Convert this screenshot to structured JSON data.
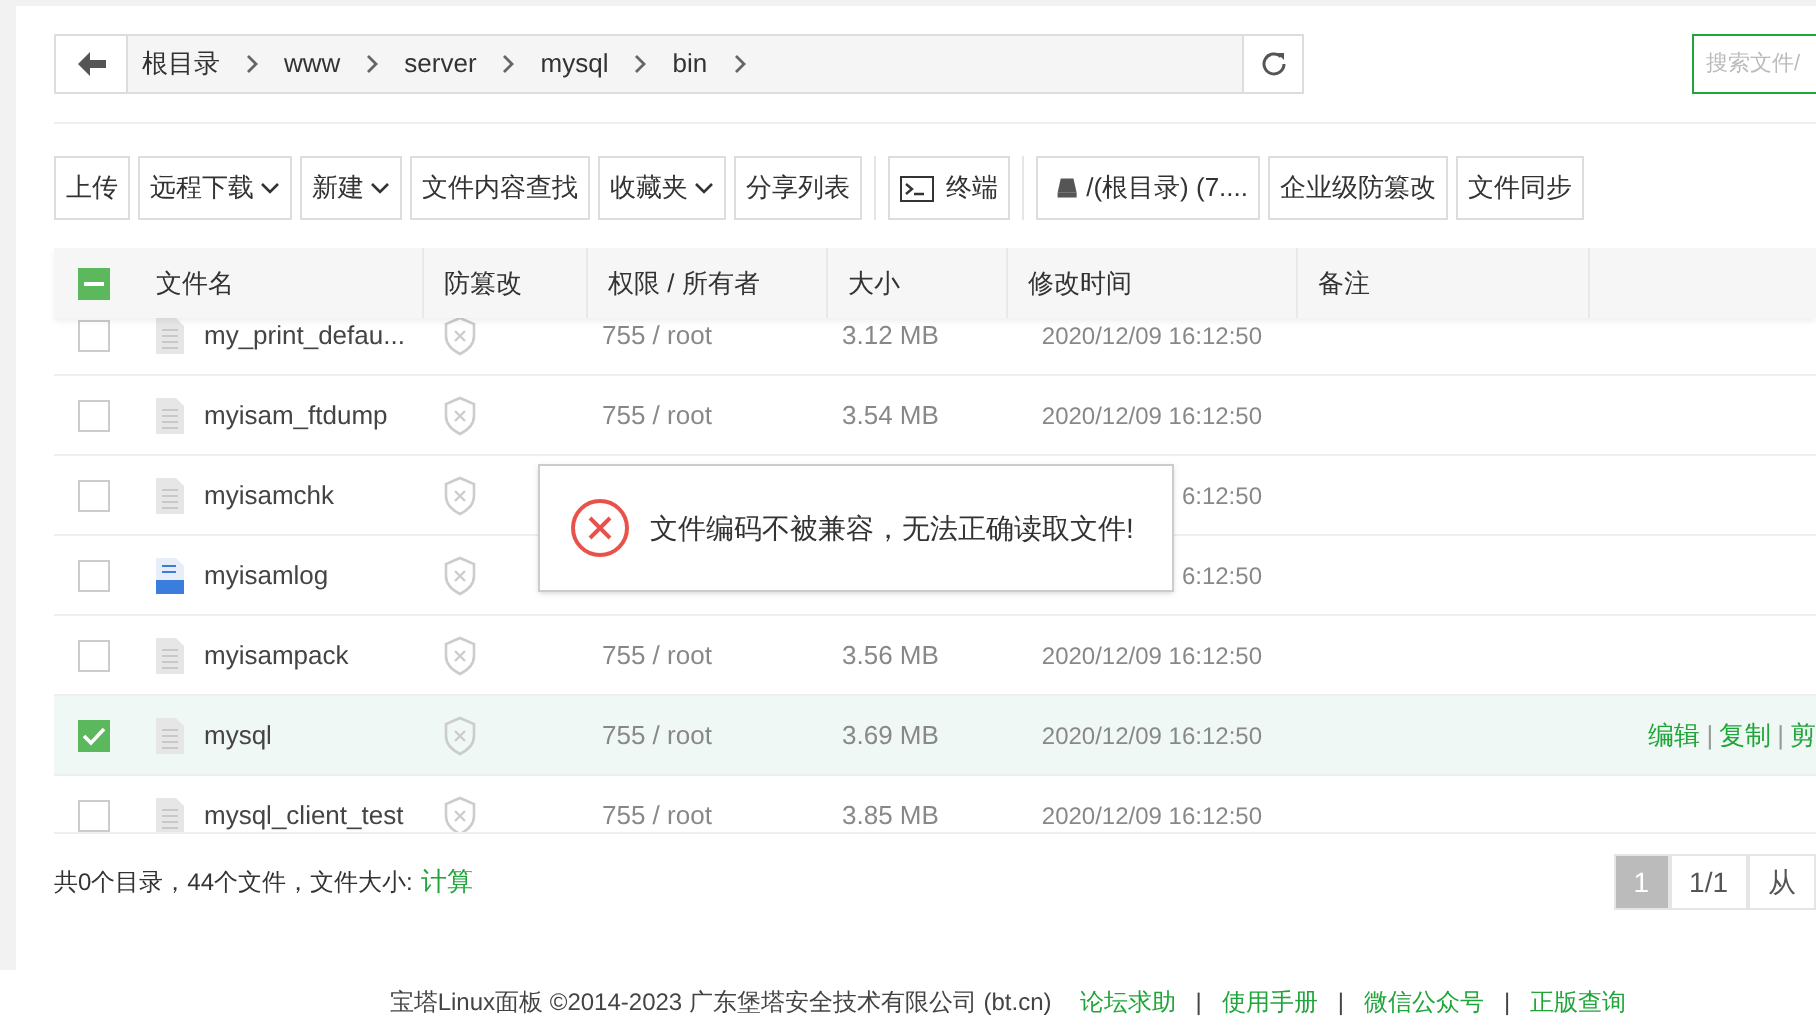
{
  "breadcrumb": [
    "根目录",
    "www",
    "server",
    "mysql",
    "bin"
  ],
  "search": {
    "placeholder": "搜索文件/"
  },
  "toolbar": [
    {
      "label": "上传",
      "kind": "plain"
    },
    {
      "label": "远程下载",
      "kind": "dropdown"
    },
    {
      "label": "新建",
      "kind": "dropdown"
    },
    {
      "label": "文件内容查找",
      "kind": "plain"
    },
    {
      "label": "收藏夹",
      "kind": "dropdown"
    },
    {
      "label": "分享列表",
      "kind": "plain"
    },
    {
      "label": "终端",
      "kind": "terminal"
    },
    {
      "label": "/(根目录) (7....",
      "kind": "disk"
    },
    {
      "label": "企业级防篡改",
      "kind": "plain"
    },
    {
      "label": "文件同步",
      "kind": "plain"
    }
  ],
  "table": {
    "select_all": {
      "indeterminate": true
    },
    "columns": [
      "文件名",
      "防篡改",
      "权限 / 所有者",
      "大小",
      "修改时间",
      "备注"
    ],
    "rows": [
      {
        "name": "my_print_defau...",
        "kind": "file",
        "permission": "755 / root",
        "size": "3.12 MB",
        "modified": "2020/12/09 16:12:50",
        "selected": false
      },
      {
        "name": "myisam_ftdump",
        "kind": "file",
        "permission": "755 / root",
        "size": "3.54 MB",
        "modified": "2020/12/09 16:12:50",
        "selected": false
      },
      {
        "name": "myisamchk",
        "kind": "file",
        "modified": "6:12:50",
        "selected": false
      },
      {
        "name": "myisamlog",
        "kind": "log",
        "modified": "6:12:50",
        "selected": false
      },
      {
        "name": "myisampack",
        "kind": "file",
        "permission": "755 / root",
        "size": "3.56 MB",
        "modified": "2020/12/09 16:12:50",
        "selected": false
      },
      {
        "name": "mysql",
        "kind": "file",
        "permission": "755 / root",
        "size": "3.69 MB",
        "modified": "2020/12/09 16:12:50",
        "selected": true,
        "actions": [
          "编辑",
          "|",
          "复制",
          "|",
          "剪"
        ]
      },
      {
        "name": "mysql_client_test",
        "kind": "file",
        "permission": "755 / root",
        "size": "3.85 MB",
        "modified": "2020/12/09 16:12:50",
        "selected": false
      }
    ]
  },
  "summary": {
    "text": "共0个目录，44个文件，文件大小:",
    "link": "计算"
  },
  "pagination": [
    {
      "label": "1",
      "selected": true
    },
    {
      "label": "1/1",
      "selected": false
    },
    {
      "label": "从",
      "selected": false
    }
  ],
  "dialog": {
    "kind": "error",
    "message": "文件编码不被兼容，无法正确读取文件!"
  },
  "footer": {
    "copyright": "宝塔Linux面板 ©2014-2023 广东堡塔安全技术有限公司 (bt.cn)",
    "links": [
      "论坛求助",
      "|",
      "使用手册",
      "|",
      "微信公众号",
      "|",
      "正版查询"
    ]
  }
}
